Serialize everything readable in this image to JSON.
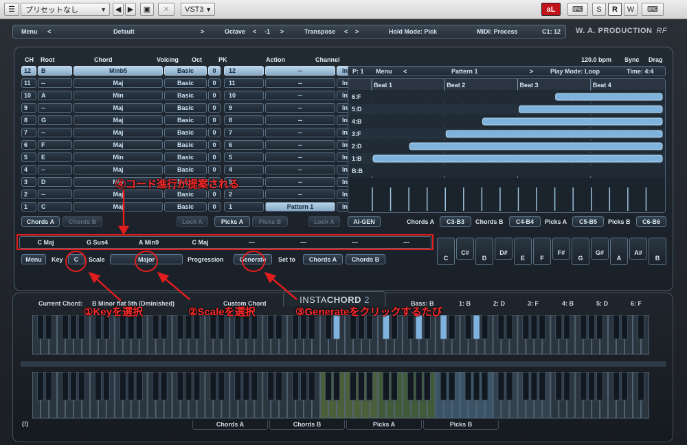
{
  "host": {
    "preset": "プリセットなし",
    "plugin_format": "VST3",
    "mode_buttons": [
      "S",
      "R",
      "W"
    ],
    "active_mode": "R"
  },
  "top_strip": {
    "menu": "Menu",
    "preset_name": "Default",
    "prev": "<",
    "next": ">",
    "octave_label": "Octave",
    "octave_value": "-1",
    "transpose_label": "Transpose",
    "hold_mode": "Hold Mode: Pick",
    "midi": "MIDI: Process",
    "c1": "C1: 12",
    "brand": "W. A. PRODUCTION",
    "brand_suffix": "RF"
  },
  "table": {
    "headers": {
      "ch": "CH",
      "root": "Root",
      "chord": "Chord",
      "voicing": "Voicing",
      "oct": "Oct",
      "pk": "PK",
      "action": "Action",
      "channel": "Channel"
    },
    "rows": [
      {
        "ch": "12",
        "root": "B",
        "chord": "Minb5",
        "voicing": "Basic",
        "oct": "0",
        "pk": "12",
        "action": "--",
        "channel": "In",
        "selected": true
      },
      {
        "ch": "11",
        "root": "--",
        "chord": "Maj",
        "voicing": "Basic",
        "oct": "0",
        "pk": "11",
        "action": "--",
        "channel": "In"
      },
      {
        "ch": "10",
        "root": "A",
        "chord": "Min",
        "voicing": "Basic",
        "oct": "0",
        "pk": "10",
        "action": "--",
        "channel": "In"
      },
      {
        "ch": "9",
        "root": "--",
        "chord": "Maj",
        "voicing": "Basic",
        "oct": "0",
        "pk": "9",
        "action": "--",
        "channel": "In"
      },
      {
        "ch": "8",
        "root": "G",
        "chord": "Maj",
        "voicing": "Basic",
        "oct": "0",
        "pk": "8",
        "action": "--",
        "channel": "In"
      },
      {
        "ch": "7",
        "root": "--",
        "chord": "Maj",
        "voicing": "Basic",
        "oct": "0",
        "pk": "7",
        "action": "--",
        "channel": "In"
      },
      {
        "ch": "6",
        "root": "F",
        "chord": "Maj",
        "voicing": "Basic",
        "oct": "0",
        "pk": "6",
        "action": "--",
        "channel": "In"
      },
      {
        "ch": "5",
        "root": "E",
        "chord": "Min",
        "voicing": "Basic",
        "oct": "0",
        "pk": "5",
        "action": "--",
        "channel": "In"
      },
      {
        "ch": "4",
        "root": "--",
        "chord": "Maj",
        "voicing": "Basic",
        "oct": "0",
        "pk": "4",
        "action": "--",
        "channel": "In"
      },
      {
        "ch": "3",
        "root": "D",
        "chord": "Min",
        "voicing": "Basic",
        "oct": "0",
        "pk": "3",
        "action": "--",
        "channel": "In"
      },
      {
        "ch": "2",
        "root": "--",
        "chord": "Maj",
        "voicing": "Basic",
        "oct": "0",
        "pk": "2",
        "action": "--",
        "channel": "In"
      },
      {
        "ch": "1",
        "root": "C",
        "chord": "Maj",
        "voicing": "Basic",
        "oct": "0",
        "pk": "1",
        "action": "Pattern 1",
        "channel": "In",
        "pattern": true
      }
    ]
  },
  "buttons": {
    "chords_a": "Chords A",
    "chords_b": "Chords B",
    "lock_a": "Lock A",
    "picks_a": "Picks A",
    "picks_b": "Picks B",
    "lock_a2": "Lock A",
    "ai_gen": "AI-GEN"
  },
  "ranges": {
    "chords_a_label": "Chords A",
    "chords_a": "C3-B3",
    "chords_b_label": "Chords B",
    "chords_b": "C4-B4",
    "picks_a_label": "Picks A",
    "picks_a": "C5-B5",
    "picks_b_label": "Picks B",
    "picks_b": "C6-B6"
  },
  "pattern": {
    "bpm": "120.0 bpm",
    "sync": "Sync",
    "drag": "Drag",
    "p": "P: 1",
    "menu": "Menu",
    "name": "Pattern 1",
    "play_mode": "Play Mode: Loop",
    "time": "Time: 4:4",
    "beats": [
      "Beat 1",
      "Beat 2",
      "Beat 3",
      "Beat 4"
    ],
    "lanes": [
      "6:F",
      "5:D",
      "4:B",
      "3:F",
      "2:D",
      "1:B",
      "B:B"
    ],
    "note_starts": [
      0.625,
      0.5,
      0.375,
      0.25,
      0.125,
      0.0
    ]
  },
  "progression": {
    "slots": [
      "C Maj",
      "G Sus4",
      "A Min9",
      "C Maj",
      "---",
      "---",
      "---",
      "---"
    ],
    "menu": "Menu",
    "key_label": "Key",
    "key_value": "C",
    "scale_label": "Scale",
    "scale_value": "Major",
    "progression_label": "Progression",
    "generate": "Generate",
    "set_to": "Set to",
    "set_a": "Chords A",
    "set_b": "Chords B"
  },
  "note_keys": [
    "C",
    "C#",
    "D",
    "D#",
    "E",
    "F",
    "F#",
    "G",
    "G#",
    "A",
    "A#",
    "B"
  ],
  "lower": {
    "logo_a": "INSTA",
    "logo_b": "CHORD",
    "logo_c": " 2",
    "current_chord_label": "Current Chord:",
    "current_chord": "B Minor flat 5th (Dminished)",
    "custom_chord": "Custom Chord",
    "bass": "Bass: B",
    "notes": [
      "1: B",
      "2: D",
      "3: F",
      "4: B",
      "5: D",
      "6: F"
    ],
    "warn": "(!)",
    "tabs": [
      "Chords A",
      "Chords B",
      "Picks A",
      "Picks B"
    ]
  },
  "annotations": {
    "step1": "①Keyを選択",
    "step2": "②Scaleを選択",
    "step3": "③Generateをクリックするたび",
    "step4": "④コード進行が提案される",
    "color": "#e21d1d"
  }
}
